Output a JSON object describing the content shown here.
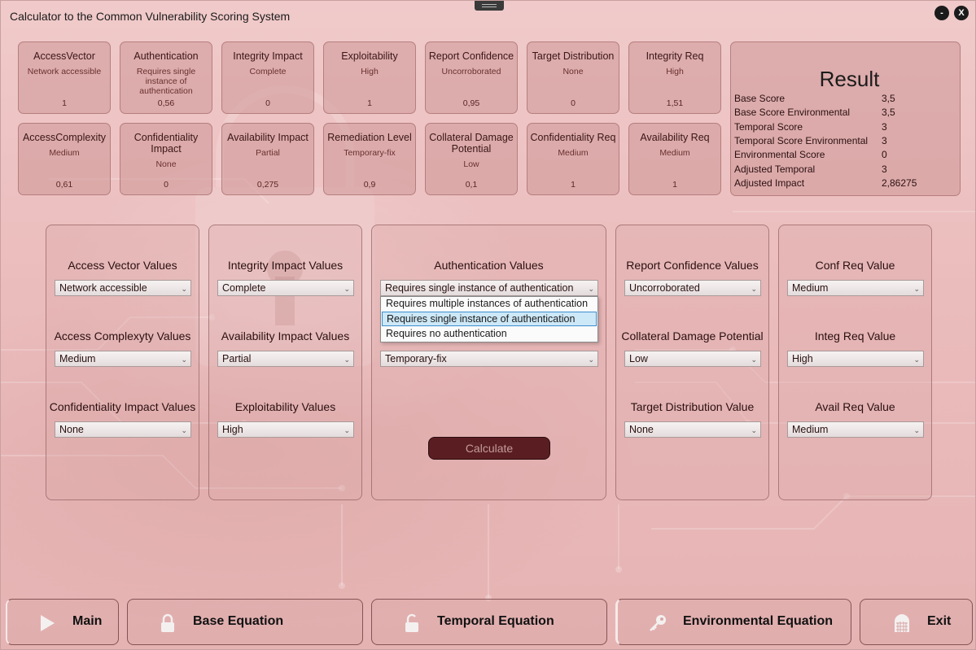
{
  "window": {
    "title": "Calculator to the Common Vulnerability Scoring System",
    "minimize_label": "-",
    "close_label": "X"
  },
  "metrics": {
    "access_vector": {
      "label": "AccessVector",
      "value": "Network accessible",
      "number": "1"
    },
    "authentication": {
      "label": "Authentication",
      "value": "Requires single instance of authentication",
      "number": "0,56"
    },
    "integrity_impact": {
      "label": "Integrity Impact",
      "value": "Complete",
      "number": "0"
    },
    "exploitability": {
      "label": "Exploitability",
      "value": "High",
      "number": "1"
    },
    "report_confidence": {
      "label": "Report Confidence",
      "value": "Uncorroborated",
      "number": "0,95"
    },
    "target_distribution": {
      "label": "Target Distribution",
      "value": "None",
      "number": "0"
    },
    "integrity_req": {
      "label": "Integrity Req",
      "value": "High",
      "number": "1,51"
    },
    "access_complexity": {
      "label": "AccessComplexity",
      "value": "Medium",
      "number": "0,61"
    },
    "confidentiality_impact": {
      "label": "Confidentiality Impact",
      "value": "None",
      "number": "0"
    },
    "availability_impact": {
      "label": "Availability Impact",
      "value": "Partial",
      "number": "0,275"
    },
    "remediation_level": {
      "label": "Remediation Level",
      "value": "Temporary-fix",
      "number": "0,9"
    },
    "collateral_damage": {
      "label": "Collateral Damage Potential",
      "value": "Low",
      "number": "0,1"
    },
    "confidentiality_req": {
      "label": "Confidentiality Req",
      "value": "Medium",
      "number": "1"
    },
    "availability_req": {
      "label": "Availability Req",
      "value": "Medium",
      "number": "1"
    }
  },
  "result": {
    "title": "Result",
    "rows": [
      {
        "label": "Base Score",
        "value": "3,5"
      },
      {
        "label": "Base Score Environmental",
        "value": "3,5"
      },
      {
        "label": "Temporal Score",
        "value": "3"
      },
      {
        "label": "Temporal Score Environmental",
        "value": "3"
      },
      {
        "label": "Environmental Score",
        "value": "0"
      },
      {
        "label": "Adjusted Temporal",
        "value": "3"
      },
      {
        "label": "Adjusted Impact",
        "value": "2,86275"
      }
    ]
  },
  "panels": {
    "p1": [
      {
        "label": "Access Vector Values",
        "selected": "Network accessible"
      },
      {
        "label": "Access Complexyty Values",
        "selected": "Medium"
      },
      {
        "label": "Confidentiality Impact Values",
        "selected": "None"
      }
    ],
    "p2": [
      {
        "label": "Integrity Impact Values",
        "selected": "Complete"
      },
      {
        "label": "Availability Impact Values",
        "selected": "Partial"
      },
      {
        "label": "Exploitability Values",
        "selected": "High"
      }
    ],
    "p3": {
      "auth": {
        "label": "Authentication Values",
        "selected": "Requires single instance of authentication"
      },
      "remediation_selected": "Temporary-fix",
      "calculate_label": "Calculate",
      "dropdown_options": [
        "Requires multiple instances of authentication",
        "Requires single instance of authentication",
        "Requires no authentication"
      ]
    },
    "p4": [
      {
        "label": "Report Confidence Values",
        "selected": "Uncorroborated"
      },
      {
        "label": "Collateral Damage Potential",
        "selected": "Low"
      },
      {
        "label": "Target Distribution Value",
        "selected": "None"
      }
    ],
    "p5": [
      {
        "label": "Conf Req Value",
        "selected": "Medium"
      },
      {
        "label": "Integ Req Value",
        "selected": "High"
      },
      {
        "label": "Avail Req Value",
        "selected": "Medium"
      }
    ]
  },
  "nav": {
    "main": "Main",
    "base": "Base Equation",
    "temporal": "Temporal Equation",
    "environmental": "Environmental Equation",
    "exit": "Exit"
  },
  "icons": {
    "play": "play-icon",
    "lock": "lock-icon",
    "unlock": "unlock-icon",
    "key": "key-icon",
    "exit": "exit-door-icon"
  }
}
